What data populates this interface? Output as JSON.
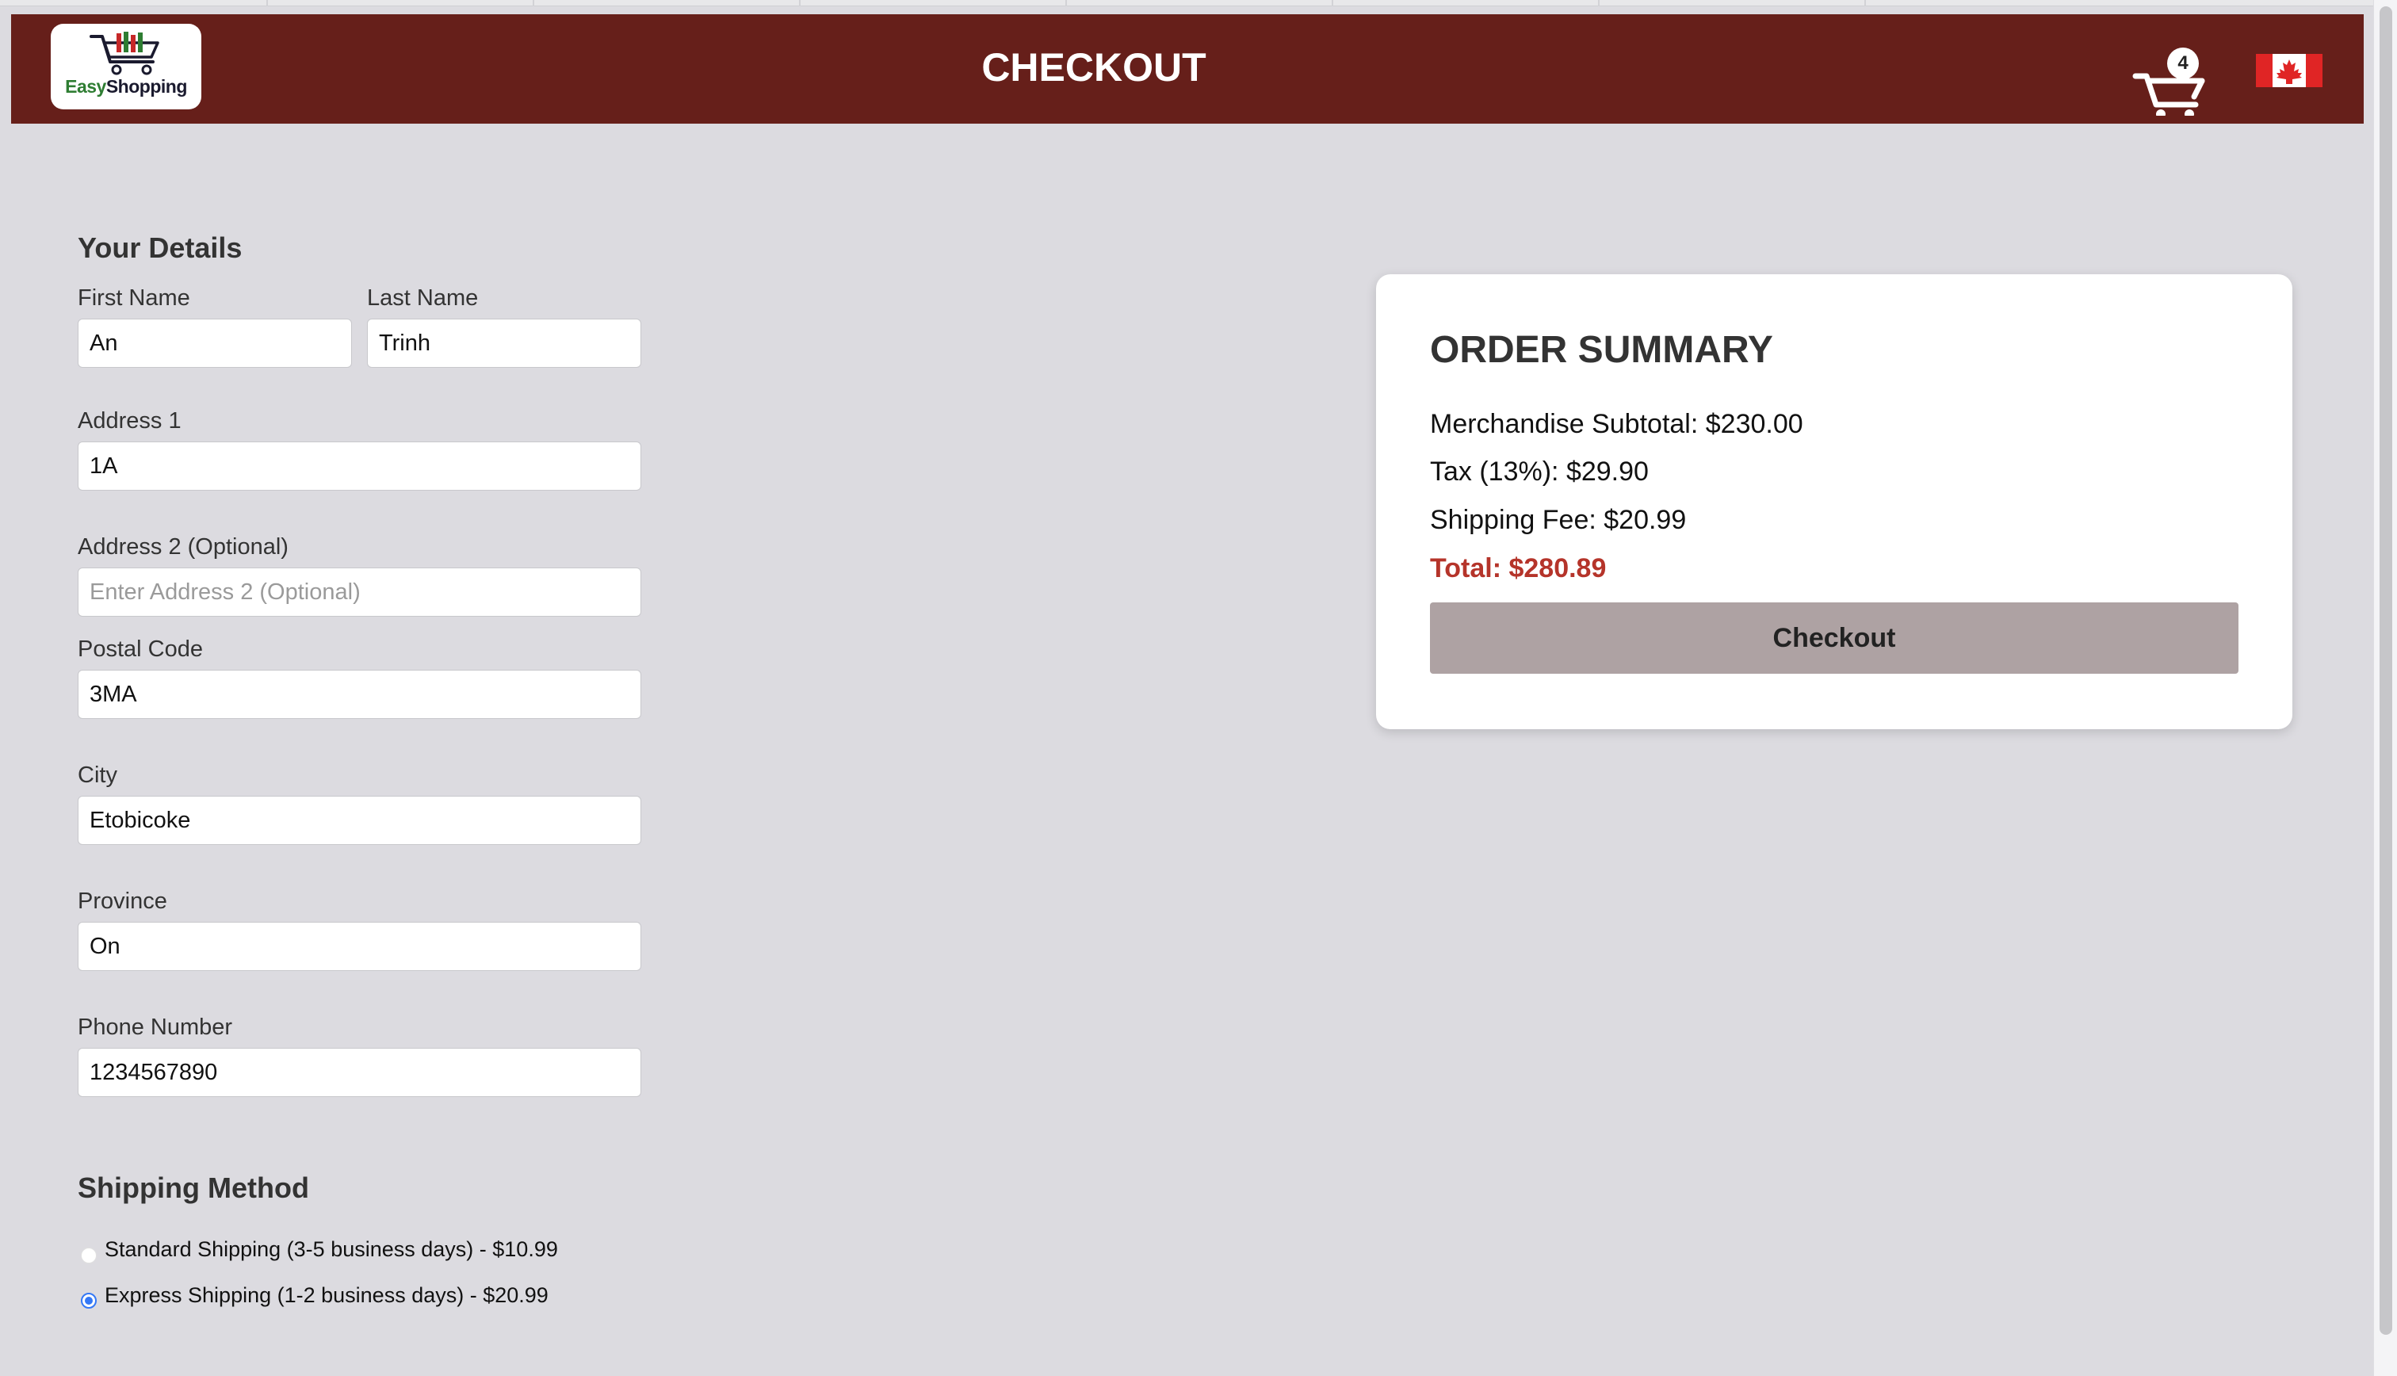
{
  "header": {
    "title": "CHECKOUT",
    "cart_count": "4",
    "brand_color": "#661f1a"
  },
  "logo": {
    "part1": "Easy",
    "part2": "Shopping"
  },
  "details": {
    "section_title": "Your Details",
    "first_name": {
      "label": "First Name",
      "value": "An"
    },
    "last_name": {
      "label": "Last Name",
      "value": "Trinh"
    },
    "address1": {
      "label": "Address 1",
      "value": "1A"
    },
    "address2": {
      "label": "Address 2 (Optional)",
      "value": "",
      "placeholder": "Enter Address 2 (Optional)"
    },
    "postal_code": {
      "label": "Postal Code",
      "value": "3MA"
    },
    "city": {
      "label": "City",
      "value": "Etobicoke"
    },
    "province": {
      "label": "Province",
      "value": "On"
    },
    "phone": {
      "label": "Phone Number",
      "value": "1234567890"
    }
  },
  "shipping": {
    "section_title": "Shipping Method",
    "options": [
      {
        "label": "Standard Shipping (3-5 business days) - $10.99",
        "selected": false
      },
      {
        "label": "Express Shipping (1-2 business days) - $20.99",
        "selected": true
      }
    ]
  },
  "summary": {
    "title": "ORDER SUMMARY",
    "subtotal": "Merchandise Subtotal: $230.00",
    "tax": "Tax (13%): $29.90",
    "shipping_fee": "Shipping Fee: $20.99",
    "total": "Total: $280.89",
    "checkout_label": "Checkout",
    "total_color": "#b5342a"
  },
  "icons": {
    "cart": "cart-icon",
    "flag": "canada-flag-icon"
  }
}
